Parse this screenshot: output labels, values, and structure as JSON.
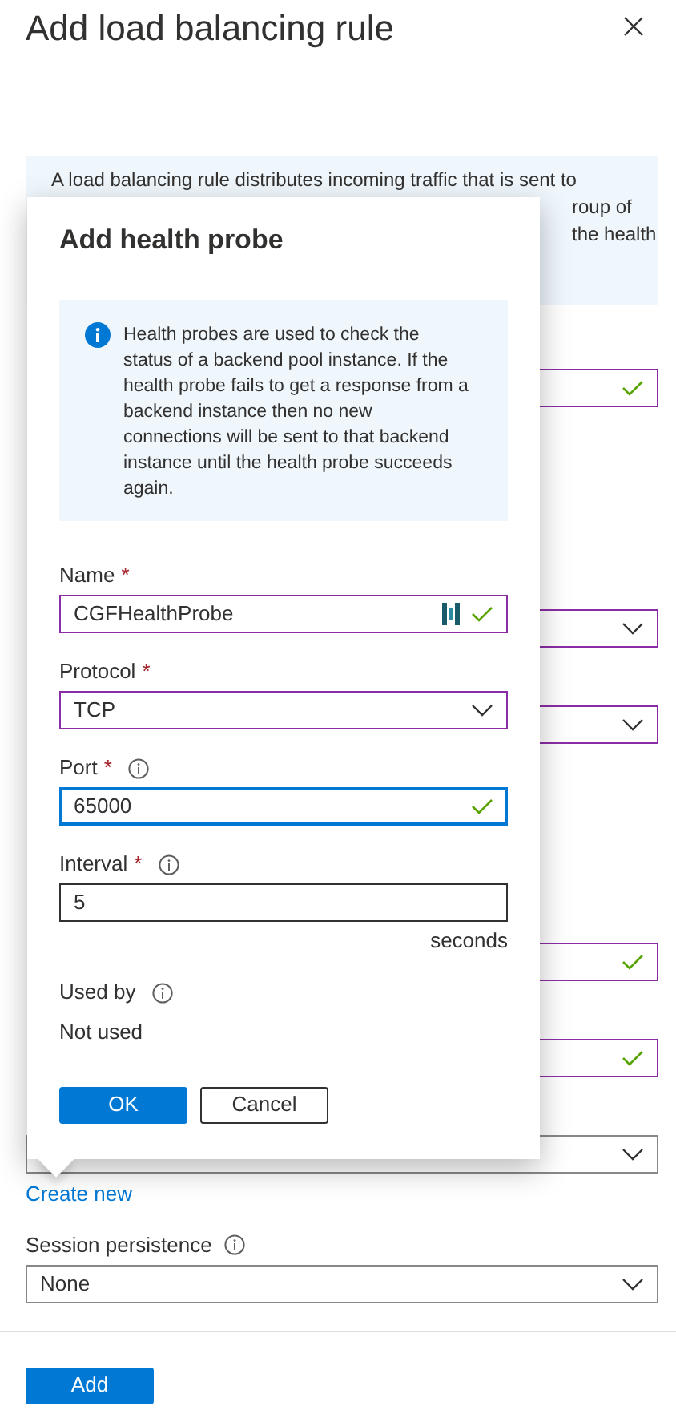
{
  "panel": {
    "title": "Add load balancing rule"
  },
  "info_banner": {
    "lines": [
      "A load balancing rule distributes incoming traffic that is sent to",
      "roup of",
      "the health"
    ]
  },
  "background_fields": [
    {
      "kind": "text",
      "highlighted": true,
      "valid": true
    },
    {
      "kind": "dropdown",
      "highlighted": true
    },
    {
      "kind": "dropdown",
      "highlighted": true
    },
    {
      "kind": "text",
      "highlighted": true,
      "valid": true
    },
    {
      "kind": "text",
      "highlighted": true,
      "valid": true
    },
    {
      "kind": "dropdown",
      "highlighted": false
    }
  ],
  "create_link": "Create new",
  "session_persistence": {
    "label": "Session persistence",
    "info": true,
    "value": "None"
  },
  "add_button": "Add",
  "dialog": {
    "title": "Add health probe",
    "info": "Health probes are used to check the status of a backend pool instance. If the health probe fails to get a response from a backend instance then no new connections will be sent to that backend instance until the health probe succeeds again.",
    "fields": [
      {
        "kind": "text",
        "label": "Name",
        "required_mark": "*",
        "value": "CGFHealthProbe",
        "highlighted": true,
        "valid": true
      },
      {
        "kind": "dropdown",
        "label": "Protocol",
        "required_mark": "*",
        "value": "TCP",
        "highlighted": true
      },
      {
        "kind": "text",
        "label": "Port",
        "required_mark": "*",
        "info": true,
        "value": "65000",
        "focused": true,
        "valid": true
      },
      {
        "kind": "text",
        "label": "Interval",
        "required_mark": "*",
        "info": true,
        "value": "5",
        "highlighted": false,
        "suffix": "seconds"
      }
    ],
    "used_by": {
      "label": "Used by",
      "info": true,
      "value": "Not used"
    },
    "buttons": [
      {
        "label": "OK",
        "primary": true
      },
      {
        "label": "Cancel",
        "primary": false
      }
    ]
  }
}
